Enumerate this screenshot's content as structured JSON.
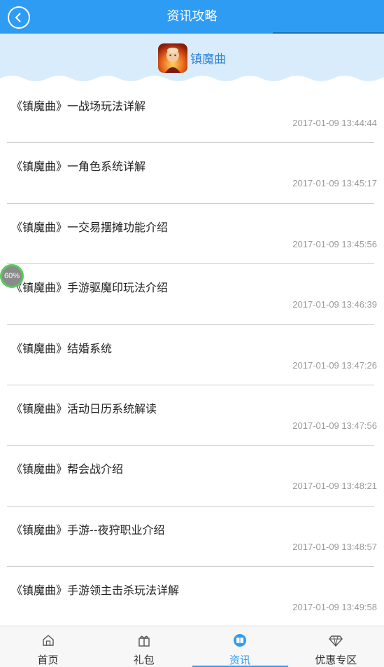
{
  "header": {
    "title": "资讯攻略",
    "back_icon": "chevron-left-icon"
  },
  "game": {
    "name": "镇魔曲",
    "icon": "game-logo-icon"
  },
  "progress": {
    "label": "60%",
    "value": 0.6
  },
  "news": [
    {
      "title": "《镇魔曲》一战场玩法详解",
      "time": "2017-01-09 13:44:44"
    },
    {
      "title": "《镇魔曲》一角色系统详解",
      "time": "2017-01-09 13:45:17"
    },
    {
      "title": "《镇魔曲》一交易摆摊功能介绍",
      "time": "2017-01-09 13:45:56"
    },
    {
      "title": "《镇魔曲》手游驱魔印玩法介绍",
      "time": "2017-01-09 13:46:39"
    },
    {
      "title": "《镇魔曲》结婚系统",
      "time": "2017-01-09 13:47:26"
    },
    {
      "title": "《镇魔曲》活动日历系统解读",
      "time": "2017-01-09 13:47:56"
    },
    {
      "title": "《镇魔曲》帮会战介绍",
      "time": "2017-01-09 13:48:21"
    },
    {
      "title": "《镇魔曲》手游--夜狩职业介绍",
      "time": "2017-01-09 13:48:57"
    },
    {
      "title": "《镇魔曲》手游领主击杀玩法详解",
      "time": "2017-01-09 13:49:58"
    }
  ],
  "tabs": [
    {
      "label": "首页",
      "icon": "home-icon",
      "active": false
    },
    {
      "label": "礼包",
      "icon": "gift-icon",
      "active": false
    },
    {
      "label": "资讯",
      "icon": "news-icon",
      "active": true
    },
    {
      "label": "优惠专区",
      "icon": "diamond-icon",
      "active": false
    }
  ],
  "colors": {
    "accent": "#2f9cf4",
    "banner_bg": "#d9ecfb",
    "time_text": "#9a9a9a"
  }
}
